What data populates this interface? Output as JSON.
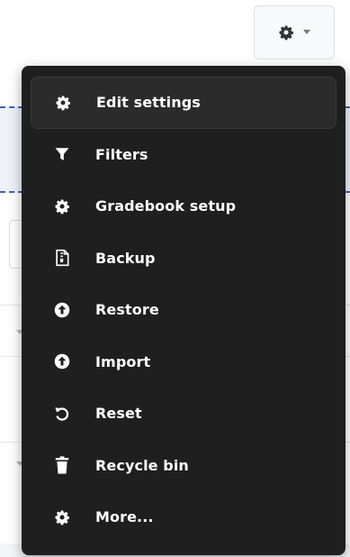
{
  "menu": {
    "items": [
      {
        "label": "Edit settings",
        "icon": "gear-icon"
      },
      {
        "label": "Filters",
        "icon": "filter-icon"
      },
      {
        "label": "Gradebook setup",
        "icon": "gear-icon"
      },
      {
        "label": "Backup",
        "icon": "file-archive-icon"
      },
      {
        "label": "Restore",
        "icon": "upload-circle-icon"
      },
      {
        "label": "Import",
        "icon": "upload-circle-icon"
      },
      {
        "label": "Reset",
        "icon": "reset-icon"
      },
      {
        "label": "Recycle bin",
        "icon": "trash-icon"
      },
      {
        "label": "More...",
        "icon": "gear-icon"
      }
    ]
  },
  "colors": {
    "menu_background": "#1f1f1f",
    "menu_text": "#ffffff",
    "active_item_background": "#2b2b2b"
  }
}
